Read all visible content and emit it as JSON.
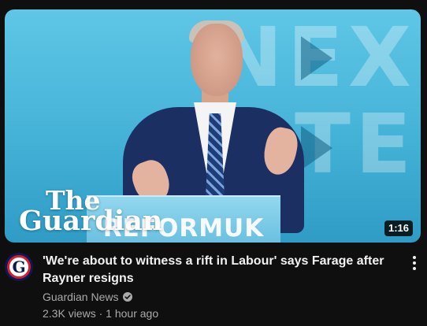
{
  "video": {
    "title": "'We're about to witness a rift in Labour' says Farage after Rayner resigns",
    "duration": "1:16",
    "channel": "Guardian News",
    "views": "2.3K views",
    "separator": "·",
    "age": "1 hour ago"
  },
  "thumbnail": {
    "logo_line1": "The",
    "logo_line2": "Guardian",
    "podium_text": "REFORMUK",
    "backdrop_text_line1": "NEX",
    "backdrop_text_line2": "TE"
  },
  "avatar": {
    "letter": "G"
  },
  "icons": {
    "verified": "verified-check-icon",
    "menu": "more-vert-icon"
  },
  "colors": {
    "background": "#0f0f0f",
    "text_primary": "#f1f1f1",
    "text_secondary": "#aaaaaa",
    "guardian_navy": "#0a1a52",
    "guardian_red": "#d21f32",
    "reform_blue": "#49b6da"
  }
}
